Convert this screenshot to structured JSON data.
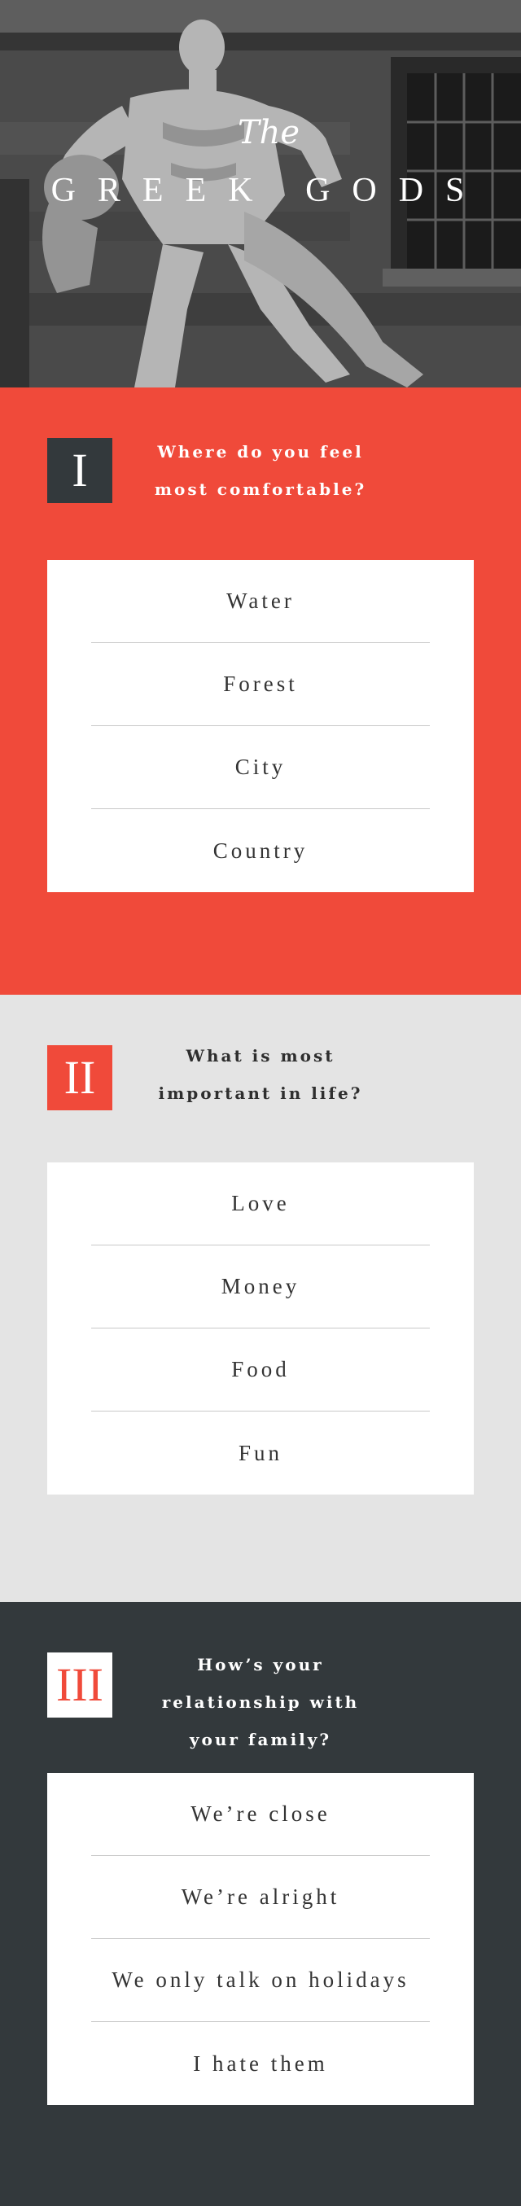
{
  "hero": {
    "the": "The",
    "title": "GREEK GODS"
  },
  "questions": [
    {
      "numeral": "I",
      "question_lines": [
        "Where do you feel",
        "most comfortable?"
      ],
      "options": [
        "Water",
        "Forest",
        "City",
        "Country"
      ]
    },
    {
      "numeral": "II",
      "question_lines": [
        "What is most",
        "important in life?"
      ],
      "options": [
        "Love",
        "Money",
        "Food",
        "Fun"
      ]
    },
    {
      "numeral": "III",
      "question_lines": [
        "How’s your",
        "relationship with",
        "your family?"
      ],
      "options": [
        "We’re close",
        "We’re alright",
        "We only talk on holidays",
        "I hate them"
      ]
    }
  ],
  "colors": {
    "red": "#f04a3a",
    "charcoal": "#33393c",
    "light_gray": "#e4e4e4",
    "white": "#ffffff"
  }
}
